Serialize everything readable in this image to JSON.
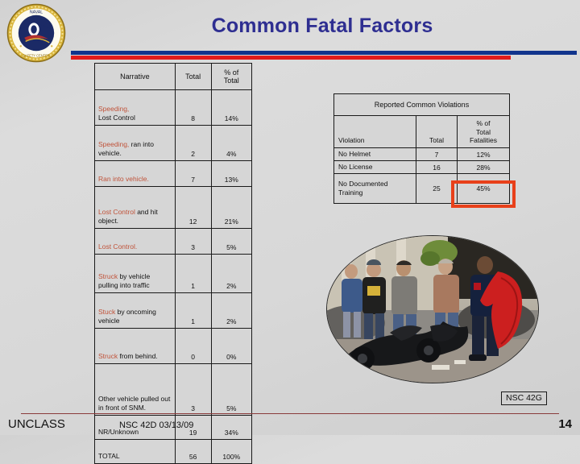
{
  "slide": {
    "title": "Common Fatal Factors",
    "logo_alt": "naval-safety-center-seal",
    "accent_blue": "#11348c",
    "accent_red": "#e21b1b",
    "title_color": "#2e2e91",
    "keyword_color": "#c0533a",
    "highlight_color": "#e8401a"
  },
  "narrative_table": {
    "headers": [
      "Narrative",
      "Total",
      "% of Total"
    ],
    "rows": [
      {
        "keyword": "Speeding,",
        "rest": "Lost Control",
        "break_after_keyword": true,
        "total": "8",
        "pct": "14%"
      },
      {
        "keyword": "Speeding,",
        "rest": " ran into vehicle.",
        "break_after_keyword": false,
        "total": "2",
        "pct": "4%"
      },
      {
        "keyword": "Ran into vehicle.",
        "rest": "",
        "break_after_keyword": false,
        "total": "7",
        "pct": "13%"
      },
      {
        "keyword": "Lost Control",
        "rest": " and hit object.",
        "break_after_keyword": false,
        "total": "12",
        "pct": "21%"
      },
      {
        "keyword": "Lost Control.",
        "rest": "",
        "break_after_keyword": false,
        "total": "3",
        "pct": "5%"
      },
      {
        "keyword": "Struck",
        "rest": " by vehicle pulling into traffic",
        "break_after_keyword": false,
        "total": "1",
        "pct": "2%"
      },
      {
        "keyword": "Stuck",
        "rest": " by oncoming vehicle",
        "break_after_keyword": false,
        "total": "1",
        "pct": "2%"
      },
      {
        "keyword": "Struck",
        "rest": " from behind.",
        "break_after_keyword": false,
        "total": "0",
        "pct": "0%"
      },
      {
        "keyword": "",
        "rest": "Other vehicle pulled out in front of SNM.",
        "break_after_keyword": false,
        "total": "3",
        "pct": "5%"
      },
      {
        "keyword": "",
        "rest": "NR/Unknown",
        "break_after_keyword": false,
        "total": "19",
        "pct": "34%"
      },
      {
        "keyword": "",
        "rest": "TOTAL",
        "break_after_keyword": false,
        "total": "56",
        "pct": "100%"
      }
    ]
  },
  "violations_table": {
    "title": "Reported Common Violations",
    "headers": [
      "Violation",
      "Total",
      "% of Total Fatalities"
    ],
    "header_pct_lines": [
      "% of",
      "Total",
      "Fatalities"
    ],
    "rows": [
      {
        "violation": "No Helmet",
        "total": "7",
        "pct": "12%",
        "highlighted": false
      },
      {
        "violation": "No License",
        "total": "16",
        "pct": "28%",
        "highlighted": false
      },
      {
        "violation": "No Documented Training",
        "total": "25",
        "pct": "45%",
        "highlighted": true
      }
    ]
  },
  "photo": {
    "caption": "motorcycle-crash-scene-photo"
  },
  "footer": {
    "classification": "UNCLASS",
    "reference": "NSC 42D 03/13/09",
    "page_number": "14",
    "office_tag": "NSC 42G"
  }
}
